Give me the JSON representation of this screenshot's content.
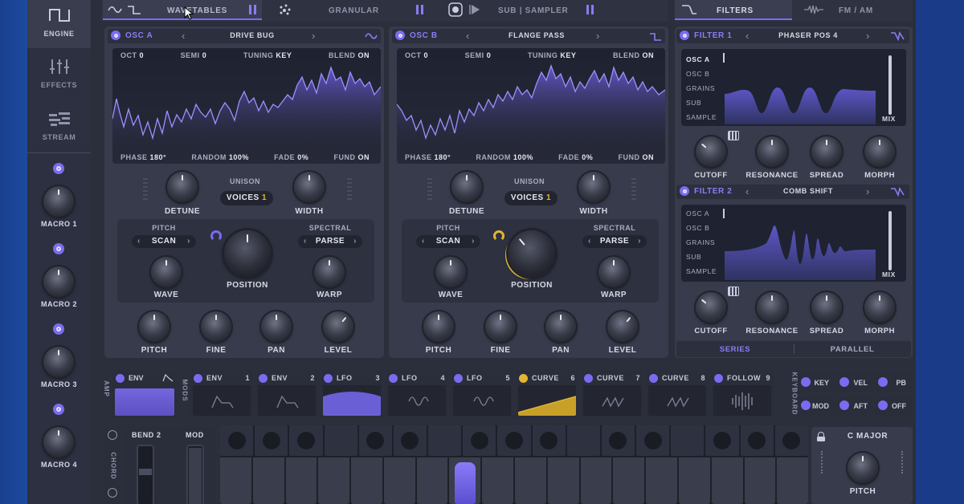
{
  "sidebar": {
    "items": [
      {
        "label": "ENGINE",
        "icon": "square-wave-icon"
      },
      {
        "label": "EFFECTS",
        "icon": "sliders-icon"
      },
      {
        "label": "STREAM",
        "icon": "stream-icon"
      }
    ],
    "macros": [
      "MACRO 1",
      "MACRO 2",
      "MACRO 3",
      "MACRO 4"
    ]
  },
  "tabs": {
    "wavetables": "WAVETABLES",
    "granular": "GRANULAR",
    "sub_sampler": "SUB | SAMPLER",
    "filters": "FILTERS",
    "fm_am": "FM / AM"
  },
  "osc_a": {
    "title": "OSC A",
    "preset": "DRIVE BUG",
    "params": {
      "oct_label": "OCT",
      "oct": "0",
      "semi_label": "SEMI",
      "semi": "0",
      "tuning_label": "TUNING",
      "tuning": "KEY",
      "blend_label": "BLEND",
      "blend": "ON"
    },
    "footer": {
      "phase_label": "PHASE",
      "phase": "180°",
      "random_label": "RANDOM",
      "random": "100%",
      "fade_label": "FADE",
      "fade": "0%",
      "fund_label": "FUND",
      "fund": "ON"
    },
    "unison": "UNISON",
    "voices_label": "VOICES",
    "voices": "1",
    "detune": "DETUNE",
    "width": "WIDTH",
    "pitch_label": "PITCH",
    "pitch_mode": "SCAN",
    "spectral_label": "SPECTRAL",
    "spectral_mode": "PARSE",
    "position": "POSITION",
    "wave": "WAVE",
    "warp": "WARP",
    "bottom": [
      "PITCH",
      "FINE",
      "PAN",
      "LEVEL"
    ]
  },
  "osc_b": {
    "title": "OSC B",
    "preset": "FLANGE PASS",
    "params": {
      "oct_label": "OCT",
      "oct": "0",
      "semi_label": "SEMI",
      "semi": "0",
      "tuning_label": "TUNING",
      "tuning": "KEY",
      "blend_label": "BLEND",
      "blend": "ON"
    },
    "footer": {
      "phase_label": "PHASE",
      "phase": "180°",
      "random_label": "RANDOM",
      "random": "100%",
      "fade_label": "FADE",
      "fade": "0%",
      "fund_label": "FUND",
      "fund": "ON"
    },
    "unison": "UNISON",
    "voices_label": "VOICES",
    "voices": "1",
    "detune": "DETUNE",
    "width": "WIDTH",
    "pitch_label": "PITCH",
    "pitch_mode": "SCAN",
    "spectral_label": "SPECTRAL",
    "spectral_mode": "PARSE",
    "position": "POSITION",
    "wave": "WAVE",
    "warp": "WARP",
    "bottom": [
      "PITCH",
      "FINE",
      "PAN",
      "LEVEL"
    ]
  },
  "filter1": {
    "title": "FILTER 1",
    "preset": "PHASER POS 4",
    "sources": [
      "OSC A",
      "OSC B",
      "GRAINS",
      "SUB",
      "SAMPLE"
    ],
    "mix": "MIX",
    "knobs": [
      "CUTOFF",
      "RESONANCE",
      "SPREAD",
      "MORPH"
    ]
  },
  "filter2": {
    "title": "FILTER 2",
    "preset": "COMB SHIFT",
    "sources": [
      "OSC A",
      "OSC B",
      "GRAINS",
      "SUB",
      "SAMPLE"
    ],
    "mix": "MIX",
    "knobs": [
      "CUTOFF",
      "RESONANCE",
      "SPREAD",
      "MORPH"
    ]
  },
  "routing": {
    "series": "SERIES",
    "parallel": "PARALLEL"
  },
  "amp": {
    "side": "AMP",
    "label": "ENV"
  },
  "mods": {
    "side": "MODS",
    "slots": [
      {
        "label": "ENV",
        "num": "1"
      },
      {
        "label": "ENV",
        "num": "2"
      },
      {
        "label": "LFO",
        "num": "3"
      },
      {
        "label": "LFO",
        "num": "4"
      },
      {
        "label": "LFO",
        "num": "5"
      },
      {
        "label": "CURVE",
        "num": "6"
      },
      {
        "label": "CURVE",
        "num": "7"
      },
      {
        "label": "CURVE",
        "num": "8"
      },
      {
        "label": "FOLLOW",
        "num": "9"
      }
    ]
  },
  "keyboard_mods": {
    "side": "KEYBOARD",
    "buttons": [
      "KEY",
      "VEL",
      "PB",
      "MOD",
      "AFT",
      "OFF"
    ]
  },
  "performance": {
    "chord": "CHORD",
    "bend": "BEND",
    "bend_val": "2",
    "mod": "MOD",
    "scale": "C MAJOR",
    "pitch": "PITCH"
  },
  "colors": {
    "accent": "#7a6cf0",
    "curve": "#e0b531",
    "bg": "#2b2e3b"
  }
}
